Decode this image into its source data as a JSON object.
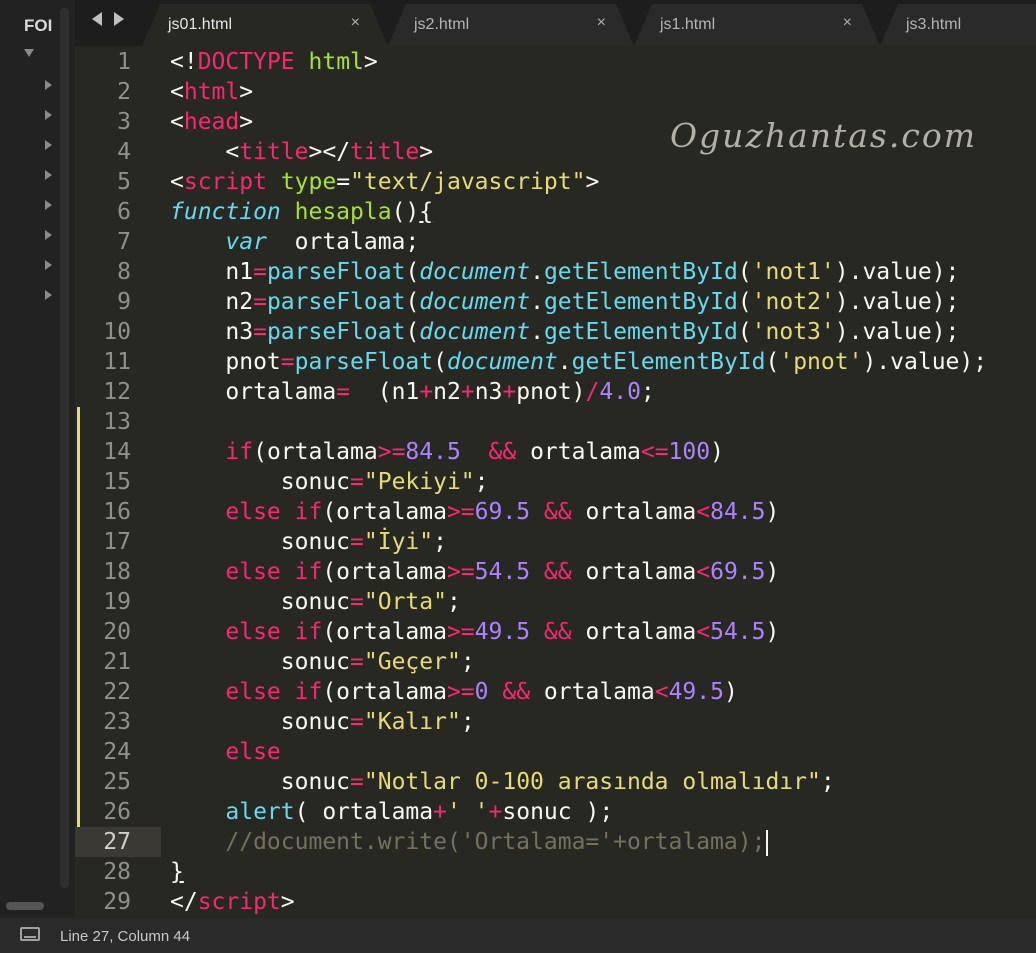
{
  "sidebar": {
    "title": "FOI"
  },
  "tabs": [
    {
      "label": "js01.html",
      "active": true,
      "close": "×"
    },
    {
      "label": "js2.html",
      "active": false,
      "close": "×"
    },
    {
      "label": "js1.html",
      "active": false,
      "close": "×"
    },
    {
      "label": "js3.html",
      "active": false,
      "close": ""
    }
  ],
  "editor": {
    "watermark": "Oguzhantas.com",
    "current_line": 27,
    "modified_lines": [
      13,
      26
    ],
    "colors": {
      "keyword": "#f92672",
      "string": "#e6db74",
      "number": "#ae81ff",
      "builtin": "#66d9ef",
      "function": "#a6e22e",
      "comment": "#75715e",
      "background": "#272822"
    },
    "lines": [
      [
        [
          "p",
          "<!"
        ],
        [
          "k",
          "DOCTYPE"
        ],
        [
          "p",
          " "
        ],
        [
          "g",
          "html"
        ],
        [
          "p",
          ">"
        ]
      ],
      [
        [
          "p",
          "<"
        ],
        [
          "k",
          "html"
        ],
        [
          "p",
          ">"
        ]
      ],
      [
        [
          "p",
          "<"
        ],
        [
          "k",
          "head"
        ],
        [
          "p",
          ">"
        ]
      ],
      [
        [
          "p",
          "    <"
        ],
        [
          "k",
          "title"
        ],
        [
          "p",
          "></"
        ],
        [
          "k",
          "title"
        ],
        [
          "p",
          ">"
        ]
      ],
      [
        [
          "p",
          "<"
        ],
        [
          "k",
          "script"
        ],
        [
          "p",
          " "
        ],
        [
          "g",
          "type"
        ],
        [
          "p",
          "="
        ],
        [
          "s",
          "\"text/javascript\""
        ],
        [
          "p",
          ">"
        ]
      ],
      [
        [
          "i",
          "function"
        ],
        [
          "p",
          " "
        ],
        [
          "g",
          "hesapla"
        ],
        [
          "p",
          "()"
        ],
        [
          "u",
          "{"
        ]
      ],
      [
        [
          "p",
          "    "
        ],
        [
          "i",
          "var"
        ],
        [
          "p",
          "  ortalama;"
        ]
      ],
      [
        [
          "p",
          "    n1"
        ],
        [
          "k",
          "="
        ],
        [
          "f",
          "parseFloat"
        ],
        [
          "p",
          "("
        ],
        [
          "i",
          "document"
        ],
        [
          "p",
          "."
        ],
        [
          "f",
          "getElementById"
        ],
        [
          "p",
          "("
        ],
        [
          "s",
          "'not1'"
        ],
        [
          "p",
          ").value);"
        ]
      ],
      [
        [
          "p",
          "    n2"
        ],
        [
          "k",
          "="
        ],
        [
          "f",
          "parseFloat"
        ],
        [
          "p",
          "("
        ],
        [
          "i",
          "document"
        ],
        [
          "p",
          "."
        ],
        [
          "f",
          "getElementById"
        ],
        [
          "p",
          "("
        ],
        [
          "s",
          "'not2'"
        ],
        [
          "p",
          ").value);"
        ]
      ],
      [
        [
          "p",
          "    n3"
        ],
        [
          "k",
          "="
        ],
        [
          "f",
          "parseFloat"
        ],
        [
          "p",
          "("
        ],
        [
          "i",
          "document"
        ],
        [
          "p",
          "."
        ],
        [
          "f",
          "getElementById"
        ],
        [
          "p",
          "("
        ],
        [
          "s",
          "'not3'"
        ],
        [
          "p",
          ").value);"
        ]
      ],
      [
        [
          "p",
          "    pnot"
        ],
        [
          "k",
          "="
        ],
        [
          "f",
          "parseFloat"
        ],
        [
          "p",
          "("
        ],
        [
          "i",
          "document"
        ],
        [
          "p",
          "."
        ],
        [
          "f",
          "getElementById"
        ],
        [
          "p",
          "("
        ],
        [
          "s",
          "'pnot'"
        ],
        [
          "p",
          ").value);"
        ]
      ],
      [
        [
          "p",
          "    ortalama"
        ],
        [
          "k",
          "="
        ],
        [
          "p",
          "  (n1"
        ],
        [
          "k",
          "+"
        ],
        [
          "p",
          "n2"
        ],
        [
          "k",
          "+"
        ],
        [
          "p",
          "n3"
        ],
        [
          "k",
          "+"
        ],
        [
          "p",
          "pnot)"
        ],
        [
          "k",
          "/"
        ],
        [
          "n",
          "4.0"
        ],
        [
          "p",
          ";"
        ]
      ],
      [],
      [
        [
          "p",
          "    "
        ],
        [
          "k",
          "if"
        ],
        [
          "p",
          "(ortalama"
        ],
        [
          "k",
          ">="
        ],
        [
          "n",
          "84.5"
        ],
        [
          "p",
          "  "
        ],
        [
          "k",
          "&&"
        ],
        [
          "p",
          " ortalama"
        ],
        [
          "k",
          "<="
        ],
        [
          "n",
          "100"
        ],
        [
          "p",
          ")"
        ]
      ],
      [
        [
          "p",
          "        sonuc"
        ],
        [
          "k",
          "="
        ],
        [
          "s",
          "\"Pekiyi\""
        ],
        [
          "p",
          ";"
        ]
      ],
      [
        [
          "p",
          "    "
        ],
        [
          "k",
          "else if"
        ],
        [
          "p",
          "(ortalama"
        ],
        [
          "k",
          ">="
        ],
        [
          "n",
          "69.5"
        ],
        [
          "p",
          " "
        ],
        [
          "k",
          "&&"
        ],
        [
          "p",
          " ortalama"
        ],
        [
          "k",
          "<"
        ],
        [
          "n",
          "84.5"
        ],
        [
          "p",
          ")"
        ]
      ],
      [
        [
          "p",
          "        sonuc"
        ],
        [
          "k",
          "="
        ],
        [
          "s",
          "\"İyi\""
        ],
        [
          "p",
          ";"
        ]
      ],
      [
        [
          "p",
          "    "
        ],
        [
          "k",
          "else if"
        ],
        [
          "p",
          "(ortalama"
        ],
        [
          "k",
          ">="
        ],
        [
          "n",
          "54.5"
        ],
        [
          "p",
          " "
        ],
        [
          "k",
          "&&"
        ],
        [
          "p",
          " ortalama"
        ],
        [
          "k",
          "<"
        ],
        [
          "n",
          "69.5"
        ],
        [
          "p",
          ")"
        ]
      ],
      [
        [
          "p",
          "        sonuc"
        ],
        [
          "k",
          "="
        ],
        [
          "s",
          "\"Orta\""
        ],
        [
          "p",
          ";"
        ]
      ],
      [
        [
          "p",
          "    "
        ],
        [
          "k",
          "else if"
        ],
        [
          "p",
          "(ortalama"
        ],
        [
          "k",
          ">="
        ],
        [
          "n",
          "49.5"
        ],
        [
          "p",
          " "
        ],
        [
          "k",
          "&&"
        ],
        [
          "p",
          " ortalama"
        ],
        [
          "k",
          "<"
        ],
        [
          "n",
          "54.5"
        ],
        [
          "p",
          ")"
        ]
      ],
      [
        [
          "p",
          "        sonuc"
        ],
        [
          "k",
          "="
        ],
        [
          "s",
          "\"Geçer\""
        ],
        [
          "p",
          ";"
        ]
      ],
      [
        [
          "p",
          "    "
        ],
        [
          "k",
          "else if"
        ],
        [
          "p",
          "(ortalama"
        ],
        [
          "k",
          ">="
        ],
        [
          "n",
          "0"
        ],
        [
          "p",
          " "
        ],
        [
          "k",
          "&&"
        ],
        [
          "p",
          " ortalama"
        ],
        [
          "k",
          "<"
        ],
        [
          "n",
          "49.5"
        ],
        [
          "p",
          ")"
        ]
      ],
      [
        [
          "p",
          "        sonuc"
        ],
        [
          "k",
          "="
        ],
        [
          "s",
          "\"Kalır\""
        ],
        [
          "p",
          ";"
        ]
      ],
      [
        [
          "p",
          "    "
        ],
        [
          "k",
          "else"
        ]
      ],
      [
        [
          "p",
          "        sonuc"
        ],
        [
          "k",
          "="
        ],
        [
          "s",
          "\"Notlar 0-100 arasında olmalıdır\""
        ],
        [
          "p",
          ";"
        ]
      ],
      [
        [
          "p",
          "    "
        ],
        [
          "f",
          "alert"
        ],
        [
          "p",
          "( ortalama"
        ],
        [
          "k",
          "+"
        ],
        [
          "s",
          "' '"
        ],
        [
          "k",
          "+"
        ],
        [
          "p",
          "sonuc );"
        ]
      ],
      [
        [
          "p",
          "    "
        ],
        [
          "c",
          "//document.write('Ortalama='+ortalama);"
        ]
      ],
      [
        [
          "u",
          "}"
        ]
      ],
      [
        [
          "p",
          "</"
        ],
        [
          "k",
          "script"
        ],
        [
          "p",
          ">"
        ]
      ]
    ]
  },
  "status": {
    "text": "Line 27, Column 44"
  }
}
